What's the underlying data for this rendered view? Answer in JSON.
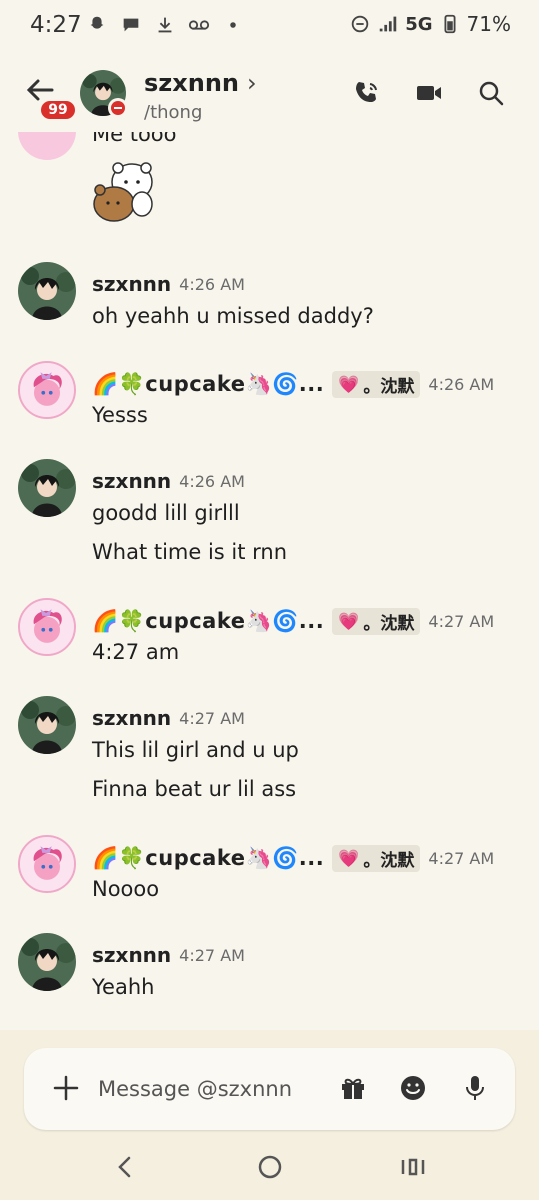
{
  "status_bar": {
    "time": "4:27",
    "network": "5G",
    "battery": "71%",
    "icons": [
      "snapchat-icon",
      "chat-bubble-icon",
      "download-icon",
      "voicemail-icon",
      "dot-icon",
      "dnd-icon",
      "signal-icon",
      "battery-icon"
    ]
  },
  "header": {
    "unread_badge": "99",
    "name": "szxnnn",
    "chevron": "›",
    "subtitle": "/thong",
    "status": "do-not-disturb"
  },
  "messages": {
    "partial": {
      "text": "Me tooo",
      "sticker": "bear-hug-sticker"
    },
    "groups": [
      {
        "author": "szxnnn",
        "time": "4:26 AM",
        "lines": [
          "oh yeahh u missed daddy?"
        ]
      },
      {
        "author": "🌈🍀cupcake🦄🌀...",
        "tag": "。沈默",
        "time": "4:26 AM",
        "lines": [
          "Yesss"
        ]
      },
      {
        "author": "szxnnn",
        "time": "4:26 AM",
        "lines": [
          "goodd lill girlll",
          "What time is it rnn"
        ]
      },
      {
        "author": "🌈🍀cupcake🦄🌀...",
        "tag": "。沈默",
        "time": "4:27 AM",
        "lines": [
          "4:27 am"
        ]
      },
      {
        "author": "szxnnn",
        "time": "4:27 AM",
        "lines": [
          "This lil girl and u up",
          "Finna beat ur lil ass"
        ]
      },
      {
        "author": "🌈🍀cupcake🦄🌀...",
        "tag": "。沈默",
        "time": "4:27 AM",
        "lines": [
          "Noooo"
        ]
      },
      {
        "author": "szxnnn",
        "time": "4:27 AM",
        "lines": [
          "Yeahh"
        ]
      }
    ]
  },
  "composer": {
    "placeholder": "Message @szxnnn"
  },
  "colors": {
    "background": "#f8f5ec",
    "badge": "#d9302c",
    "tag_bg": "#e8e3d7",
    "composer_bg": "#f5efdf"
  }
}
